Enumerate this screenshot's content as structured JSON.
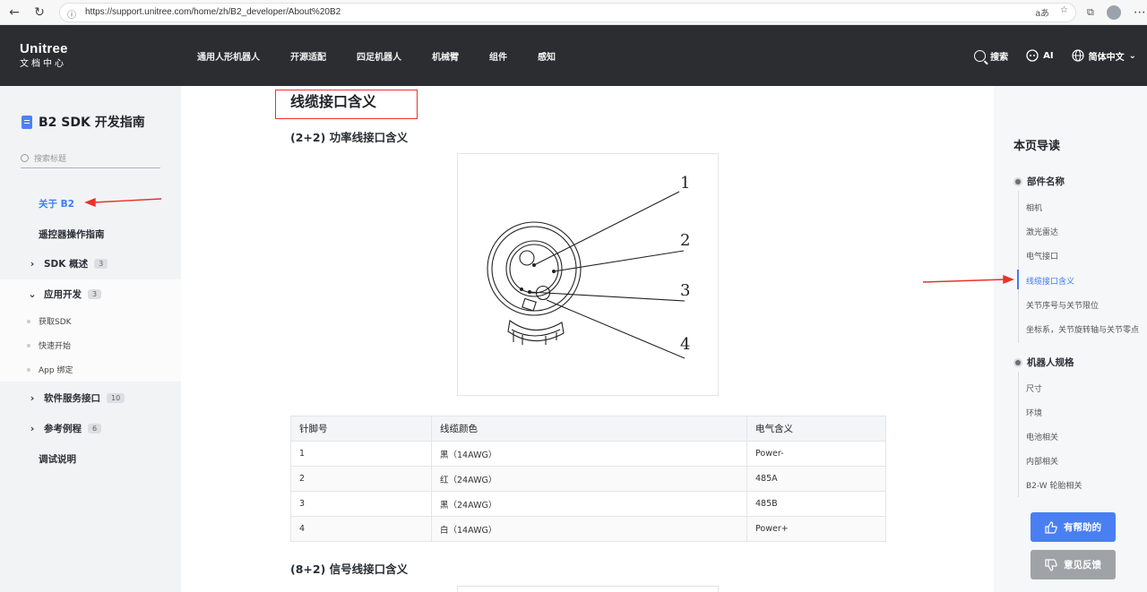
{
  "browser": {
    "url": "https://support.unitree.com/home/zh/B2_developer/About%20B2",
    "reader_label": "aあ"
  },
  "header": {
    "logo_line1": "Unitree",
    "logo_line2": "文档中心",
    "menu": [
      "通用人形机器人",
      "开源适配",
      "四足机器人",
      "机械臂",
      "组件",
      "感知"
    ],
    "search_label": "搜索",
    "ai_label": "AI",
    "lang_label": "简体中文"
  },
  "sidebar": {
    "title": "B2 SDK 开发指南",
    "search_placeholder": "搜索标题",
    "items": {
      "about": "关于 B2",
      "remote": "遥控器操作指南",
      "sdk_overview": "SDK 概述",
      "sdk_overview_count": "3",
      "app_dev": "应用开发",
      "app_dev_count": "3",
      "get_sdk": "获取SDK",
      "quick_start": "快速开始",
      "app_bind": "App 绑定",
      "services": "软件服务接口",
      "services_count": "10",
      "examples": "参考例程",
      "examples_count": "6",
      "debug": "调试说明"
    }
  },
  "main": {
    "heading": "线缆接口含义",
    "sub1": "(2+2) 功率线接口含义",
    "sub2": "(8+2) 信号线接口含义",
    "figure_labels": [
      "1",
      "2",
      "3",
      "4"
    ],
    "table": {
      "headers": [
        "针脚号",
        "线缆颜色",
        "电气含义"
      ],
      "rows": [
        [
          "1",
          "黑（14AWG）",
          "Power-"
        ],
        [
          "2",
          "红（24AWG）",
          "485A"
        ],
        [
          "3",
          "黑（24AWG）",
          "485B"
        ],
        [
          "4",
          "白（14AWG）",
          "Power+"
        ]
      ]
    }
  },
  "toc": {
    "title": "本页导读",
    "section1": "部件名称",
    "section1_items": [
      "相机",
      "激光雷达",
      "电气接口",
      "线缆接口含义",
      "关节序号与关节限位",
      "坐标系，关节旋转轴与关节零点"
    ],
    "section2": "机器人规格",
    "section2_items": [
      "尺寸",
      "环境",
      "电池相关",
      "内部相关",
      "B2-W 轮胎相关"
    ],
    "helpful_label": "有帮助的",
    "feedback_label": "意见反馈"
  },
  "colors": {
    "accent": "#3f7cf2",
    "nav_bg": "#2b2d31",
    "annotation_red": "#e8322a"
  }
}
